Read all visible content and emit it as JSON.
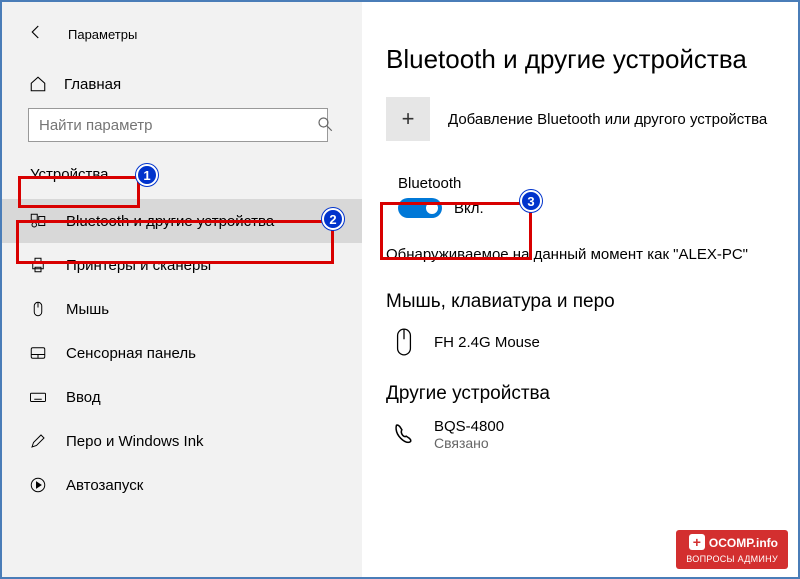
{
  "app_title": "Параметры",
  "sidebar": {
    "home": "Главная",
    "search_placeholder": "Найти параметр",
    "section": "Устройства",
    "items": [
      {
        "label": "Bluetooth и другие устройства"
      },
      {
        "label": "Принтеры и сканеры"
      },
      {
        "label": "Мышь"
      },
      {
        "label": "Сенсорная панель"
      },
      {
        "label": "Ввод"
      },
      {
        "label": "Перо и Windows Ink"
      },
      {
        "label": "Автозапуск"
      }
    ]
  },
  "main": {
    "title": "Bluetooth и другие устройства",
    "add_device": "Добавление Bluetooth или другого устройства",
    "bt_label": "Bluetooth",
    "bt_state": "Вкл.",
    "discoverable": "Обнаруживаемое на данный момент как \"ALEX-PC\"",
    "section_mouse": "Мышь, клавиатура и перо",
    "device_mouse": "FH 2.4G Mouse",
    "section_other": "Другие устройства",
    "device_other": "BQS-4800",
    "device_other_status": "Связано"
  },
  "annotations": {
    "b1": "1",
    "b2": "2",
    "b3": "3"
  },
  "watermark": {
    "line1": "OCOMP.info",
    "line2": "ВОПРОСЫ АДМИНУ"
  }
}
